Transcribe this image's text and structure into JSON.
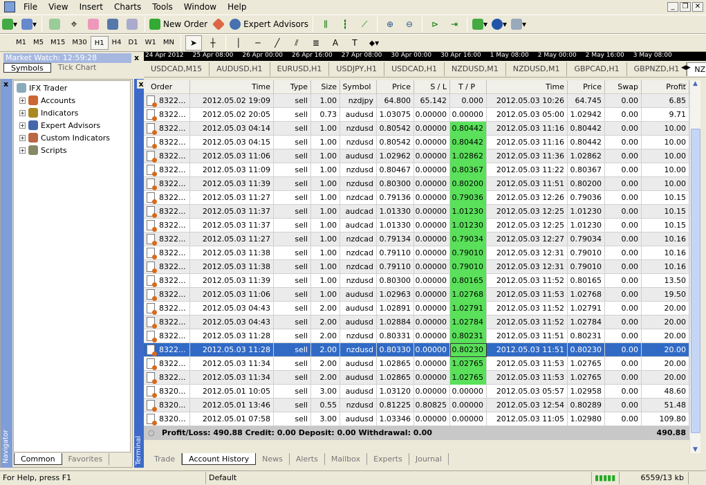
{
  "menu": [
    "File",
    "View",
    "Insert",
    "Charts",
    "Tools",
    "Window",
    "Help"
  ],
  "toolbar": {
    "new_order": "New Order",
    "expert_advisors": "Expert Advisors"
  },
  "timeframes": [
    "M1",
    "M5",
    "M15",
    "M30",
    "H1",
    "H4",
    "D1",
    "W1",
    "MN"
  ],
  "active_timeframe": "H1",
  "time_strip": [
    "24 Apr 2012",
    "25 Apr 08:00",
    "26 Apr 00:00",
    "26 Apr 16:00",
    "27 Apr 08:00",
    "30 Apr 00:00",
    "30 Apr 16:00",
    "1 May 08:00",
    "2 May 00:00",
    "2 May 16:00",
    "3 May 08:00"
  ],
  "chart_tabs": [
    "USDCAD,M15",
    "AUDUSD,H1",
    "EURUSD,H1",
    "USDJPY,H1",
    "USDCAD,H1",
    "NZDUSD,M1",
    "NZDUSD,M1",
    "GBPCAD,H1",
    "GBPNZD,H1",
    "NZDCAD"
  ],
  "market_watch": {
    "title": "Market Watch: 12:59:28",
    "tabs": [
      "Symbols",
      "Tick Chart"
    ]
  },
  "navigator": {
    "label": "Navigator",
    "root": "IFX Trader",
    "items": [
      "Accounts",
      "Indicators",
      "Expert Advisors",
      "Custom Indicators",
      "Scripts"
    ],
    "tabs": [
      "Common",
      "Favorites"
    ]
  },
  "terminal": {
    "label": "Terminal",
    "tabs": [
      "Trade",
      "Account History",
      "News",
      "Alerts",
      "Mailbox",
      "Experts",
      "Journal"
    ],
    "active_tab": "Account History"
  },
  "columns": [
    "Order",
    "Time",
    "Type",
    "Size",
    "Symbol",
    "Price",
    "S / L",
    "T / P",
    "Time",
    "Price",
    "Swap",
    "Profit"
  ],
  "rows": [
    [
      "8322...",
      "2012.05.02 19:09",
      "sell",
      "1.00",
      "nzdjpy",
      "64.800",
      "65.142",
      "0.000",
      "2012.05.03 10:26",
      "64.745",
      "0.00",
      "6.85"
    ],
    [
      "8322...",
      "2012.05.02 20:05",
      "sell",
      "0.73",
      "audusd",
      "1.03075",
      "0.00000",
      "0.00000",
      "2012.05.03 05:00",
      "1.02942",
      "0.00",
      "9.71"
    ],
    [
      "8322...",
      "2012.05.03 04:14",
      "sell",
      "1.00",
      "nzdusd",
      "0.80542",
      "0.00000",
      "0.80442",
      "2012.05.03 11:16",
      "0.80442",
      "0.00",
      "10.00"
    ],
    [
      "8322...",
      "2012.05.03 04:15",
      "sell",
      "1.00",
      "nzdusd",
      "0.80542",
      "0.00000",
      "0.80442",
      "2012.05.03 11:16",
      "0.80442",
      "0.00",
      "10.00"
    ],
    [
      "8322...",
      "2012.05.03 11:06",
      "sell",
      "1.00",
      "audusd",
      "1.02962",
      "0.00000",
      "1.02862",
      "2012.05.03 11:36",
      "1.02862",
      "0.00",
      "10.00"
    ],
    [
      "8322...",
      "2012.05.03 11:09",
      "sell",
      "1.00",
      "nzdusd",
      "0.80467",
      "0.00000",
      "0.80367",
      "2012.05.03 11:22",
      "0.80367",
      "0.00",
      "10.00"
    ],
    [
      "8322...",
      "2012.05.03 11:39",
      "sell",
      "1.00",
      "nzdusd",
      "0.80300",
      "0.00000",
      "0.80200",
      "2012.05.03 11:51",
      "0.80200",
      "0.00",
      "10.00"
    ],
    [
      "8322...",
      "2012.05.03 11:27",
      "sell",
      "1.00",
      "nzdcad",
      "0.79136",
      "0.00000",
      "0.79036",
      "2012.05.03 12:26",
      "0.79036",
      "0.00",
      "10.15"
    ],
    [
      "8322...",
      "2012.05.03 11:37",
      "sell",
      "1.00",
      "audcad",
      "1.01330",
      "0.00000",
      "1.01230",
      "2012.05.03 12:25",
      "1.01230",
      "0.00",
      "10.15"
    ],
    [
      "8322...",
      "2012.05.03 11:37",
      "sell",
      "1.00",
      "audcad",
      "1.01330",
      "0.00000",
      "1.01230",
      "2012.05.03 12:25",
      "1.01230",
      "0.00",
      "10.15"
    ],
    [
      "8322...",
      "2012.05.03 11:27",
      "sell",
      "1.00",
      "nzdcad",
      "0.79134",
      "0.00000",
      "0.79034",
      "2012.05.03 12:27",
      "0.79034",
      "0.00",
      "10.16"
    ],
    [
      "8322...",
      "2012.05.03 11:38",
      "sell",
      "1.00",
      "nzdcad",
      "0.79110",
      "0.00000",
      "0.79010",
      "2012.05.03 12:31",
      "0.79010",
      "0.00",
      "10.16"
    ],
    [
      "8322...",
      "2012.05.03 11:38",
      "sell",
      "1.00",
      "nzdcad",
      "0.79110",
      "0.00000",
      "0.79010",
      "2012.05.03 12:31",
      "0.79010",
      "0.00",
      "10.16"
    ],
    [
      "8322...",
      "2012.05.03 11:39",
      "sell",
      "1.00",
      "nzdusd",
      "0.80300",
      "0.00000",
      "0.80165",
      "2012.05.03 11:52",
      "0.80165",
      "0.00",
      "13.50"
    ],
    [
      "8322...",
      "2012.05.03 11:06",
      "sell",
      "1.00",
      "audusd",
      "1.02963",
      "0.00000",
      "1.02768",
      "2012.05.03 11:53",
      "1.02768",
      "0.00",
      "19.50"
    ],
    [
      "8322...",
      "2012.05.03 04:43",
      "sell",
      "2.00",
      "audusd",
      "1.02891",
      "0.00000",
      "1.02791",
      "2012.05.03 11:52",
      "1.02791",
      "0.00",
      "20.00"
    ],
    [
      "8322...",
      "2012.05.03 04:43",
      "sell",
      "2.00",
      "audusd",
      "1.02884",
      "0.00000",
      "1.02784",
      "2012.05.03 11:52",
      "1.02784",
      "0.00",
      "20.00"
    ],
    [
      "8322...",
      "2012.05.03 11:28",
      "sell",
      "2.00",
      "nzdusd",
      "0.80331",
      "0.00000",
      "0.80231",
      "2012.05.03 11:51",
      "0.80231",
      "0.00",
      "20.00"
    ],
    [
      "8322...",
      "2012.05.03 11:28",
      "sell",
      "2.00",
      "nzdusd",
      "0.80330",
      "0.00000",
      "0.80230",
      "2012.05.03 11:51",
      "0.80230",
      "0.00",
      "20.00"
    ],
    [
      "8322...",
      "2012.05.03 11:34",
      "sell",
      "2.00",
      "audusd",
      "1.02865",
      "0.00000",
      "1.02765",
      "2012.05.03 11:53",
      "1.02765",
      "0.00",
      "20.00"
    ],
    [
      "8322...",
      "2012.05.03 11:34",
      "sell",
      "2.00",
      "audusd",
      "1.02865",
      "0.00000",
      "1.02765",
      "2012.05.03 11:53",
      "1.02765",
      "0.00",
      "20.00"
    ],
    [
      "8320...",
      "2012.05.01 10:05",
      "sell",
      "3.00",
      "audusd",
      "1.03120",
      "0.00000",
      "0.00000",
      "2012.05.03 05:57",
      "1.02958",
      "0.00",
      "48.60"
    ],
    [
      "8320...",
      "2012.05.01 13:46",
      "sell",
      "0.55",
      "nzdusd",
      "0.81225",
      "0.80825",
      "0.00000",
      "2012.05.03 12:54",
      "0.80289",
      "0.00",
      "51.48"
    ],
    [
      "8320...",
      "2012.05.01 07:58",
      "sell",
      "3.00",
      "audusd",
      "1.03346",
      "0.00000",
      "0.00000",
      "2012.05.03 11:05",
      "1.02980",
      "0.00",
      "109.80"
    ]
  ],
  "selected_row": 18,
  "summary": {
    "text": "Profit/Loss: 490.88  Credit: 0.00  Deposit: 0.00  Withdrawal: 0.00",
    "total": "490.88"
  },
  "status": {
    "help": "For Help, press F1",
    "profile": "Default",
    "traffic": "6559/13 kb"
  },
  "colors": {
    "tp_hit": "#5ae05a",
    "selection": "#316ac5",
    "terminal_bar": "#3d6ac8"
  }
}
